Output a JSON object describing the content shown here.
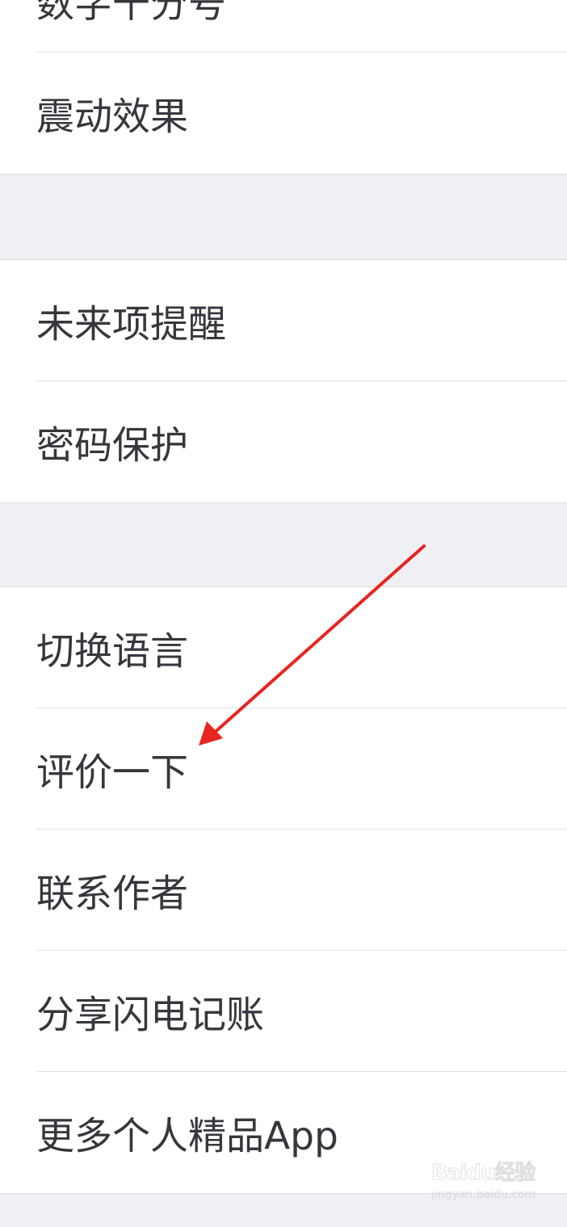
{
  "settings": {
    "group1": [
      {
        "label": "数字千分号"
      },
      {
        "label": "震动效果"
      }
    ],
    "group2": [
      {
        "label": "未来项提醒"
      },
      {
        "label": "密码保护"
      }
    ],
    "group3": [
      {
        "label": "切换语言"
      },
      {
        "label": "评价一下"
      },
      {
        "label": "联系作者"
      },
      {
        "label": "分享闪电记账"
      },
      {
        "label": "更多个人精品App"
      }
    ]
  },
  "annotation": {
    "arrow_color": "#e8241f"
  },
  "watermark": {
    "logo": "Baidu经验",
    "sub": "jingyan.baidu.com"
  },
  "colors": {
    "background": "#efeff4",
    "row": "#ffffff",
    "text": "#35373c",
    "separator": "#e1e1e5"
  }
}
